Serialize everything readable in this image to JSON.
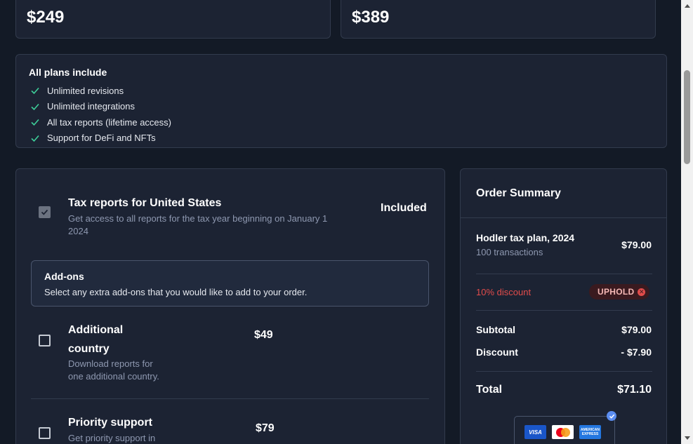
{
  "plan_cards": [
    {
      "price": "$249"
    },
    {
      "price": "$389"
    }
  ],
  "all_plans": {
    "title": "All plans include",
    "features": [
      "Unlimited revisions",
      "Unlimited integrations",
      "All tax reports (lifetime access)",
      "Support for DeFi and NFTs"
    ]
  },
  "tax_report": {
    "title": "Tax reports for United States",
    "description_line1": "Get access to all reports for the tax year beginning on January 1",
    "description_line2": "2024",
    "status": "Included",
    "checked": true
  },
  "addons": {
    "title": "Add-ons",
    "description": "Select any extra add-ons that you would like to add to your order.",
    "items": [
      {
        "title_line1": "Additional",
        "title_line2": "country",
        "description_line1": "Download reports for",
        "description_line2": "one additional country.",
        "price": "$49"
      },
      {
        "title_line1": "Priority support",
        "description_line1": "Get priority support in",
        "price": "$79"
      }
    ]
  },
  "order_summary": {
    "title": "Order Summary",
    "plan_name": "Hodler tax plan, 2024",
    "plan_detail": "100 transactions",
    "plan_price": "$79.00",
    "discount_text": "10% discount",
    "coupon_code": "UPHOLD",
    "subtotal_label": "Subtotal",
    "subtotal_value": "$79.00",
    "discount_label": "Discount",
    "discount_value": "- $7.90",
    "total_label": "Total",
    "total_value": "$71.10",
    "payment_methods": [
      "VISA",
      "Mastercard",
      "AMERICAN EXPRESS"
    ]
  },
  "colors": {
    "background": "#131a26",
    "card": "#1c2333",
    "accent_check": "#3ecf9a",
    "discount_red": "#e24c4b"
  }
}
